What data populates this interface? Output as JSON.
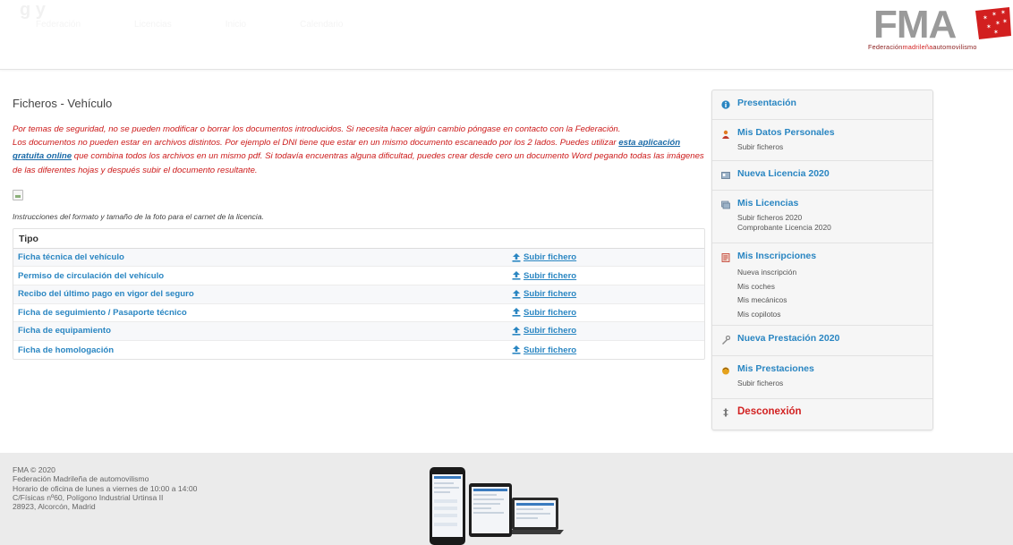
{
  "header": {
    "brand_ghost": "g     y",
    "nav_ghost": [
      "Federación",
      "Licencias",
      "Inicio",
      "Calendario"
    ],
    "logo": {
      "letters": "FMA",
      "sub_dark_1": "Federación",
      "sub_red": "madrileña",
      "sub_dark_2": "automovilismo"
    }
  },
  "main": {
    "title": "Ficheros - Vehículo",
    "notice_line_1": "Por temas de seguridad, no se pueden modificar o borrar los documentos introducidos. Si necesita hacer algún cambio póngase en contacto con la Federación.",
    "notice_line_2_pre": "Los documentos no pueden estar en archivos distintos. Por ejemplo el DNI tiene que estar en un mismo documento escaneado por los 2 lados. Puedes utilizar ",
    "notice_link": "esta aplicación gratuita online",
    "notice_line_2_post": " que combina todos los archivos en un mismo pdf. Si todavía encuentras alguna dificultad, puedes crear desde cero un documento Word pegando todas las imágenes de las diferentes hojas y después subir el documento resultante.",
    "instructions": "Instrucciones del formato y tamaño de la foto para el carnet de la licencia.",
    "table_header": "Tipo",
    "upload_label": "Subir fichero",
    "rows": [
      {
        "name": "Ficha técnica del vehículo"
      },
      {
        "name": "Permiso de circulación del vehículo"
      },
      {
        "name": "Recibo del último pago en vigor del seguro"
      },
      {
        "name": "Ficha de seguimiento / Pasaporte técnico"
      },
      {
        "name": "Ficha de equipamiento"
      },
      {
        "name": "Ficha de homologación"
      }
    ]
  },
  "sidebar": {
    "presentacion": "Presentación",
    "datos": {
      "title": "Mis Datos Personales",
      "subs": [
        "Subir ficheros"
      ]
    },
    "nueva_licencia": "Nueva Licencia 2020",
    "licencias": {
      "title": "Mis Licencias",
      "subs": [
        "Subir ficheros 2020",
        "Comprobante Licencia 2020"
      ]
    },
    "inscripciones": {
      "title": "Mis Inscripciones",
      "subs": [
        "Nueva inscripción",
        "Mis coches",
        "Mis mecánicos",
        "Mis copilotos"
      ]
    },
    "nueva_prestacion": "Nueva Prestación 2020",
    "prestaciones": {
      "title": "Mis Prestaciones",
      "subs": [
        "Subir ficheros"
      ]
    },
    "desconexion": "Desconexión"
  },
  "footer": {
    "lines": [
      "FMA © 2020",
      "Federación Madrileña de automovilismo",
      "Horario de oficina de lunes a viernes de 10:00 a 14:00",
      "C/Físicas nº60, Polígono Industrial Urtinsa II",
      "28923, Alcorcón, Madrid"
    ]
  },
  "colors": {
    "link": "#2a86c2",
    "notice_red": "#cc1a1a",
    "logo_red": "#d21f1f",
    "sidebar_bg": "#f6f6f6",
    "footer_bg": "#ebebeb"
  }
}
